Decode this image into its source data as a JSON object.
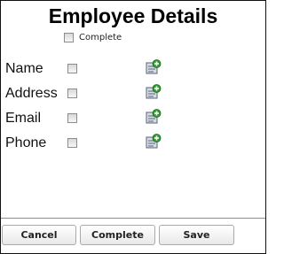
{
  "title": "Employee Details",
  "complete_checkbox": {
    "label": "Complete",
    "checked": false
  },
  "fields": [
    {
      "label": "Name",
      "checked": false,
      "icon": "add-note-icon"
    },
    {
      "label": "Address",
      "checked": false,
      "icon": "add-note-icon"
    },
    {
      "label": "Email",
      "checked": false,
      "icon": "add-note-icon"
    },
    {
      "label": "Phone",
      "checked": false,
      "icon": "add-note-icon"
    }
  ],
  "buttons": {
    "cancel_label": "Cancel",
    "complete_label": "Complete",
    "save_label": "Save"
  },
  "colors": {
    "icon_green": "#2e9e2e",
    "icon_doc": "#d6dbe6",
    "border": "#111111"
  }
}
